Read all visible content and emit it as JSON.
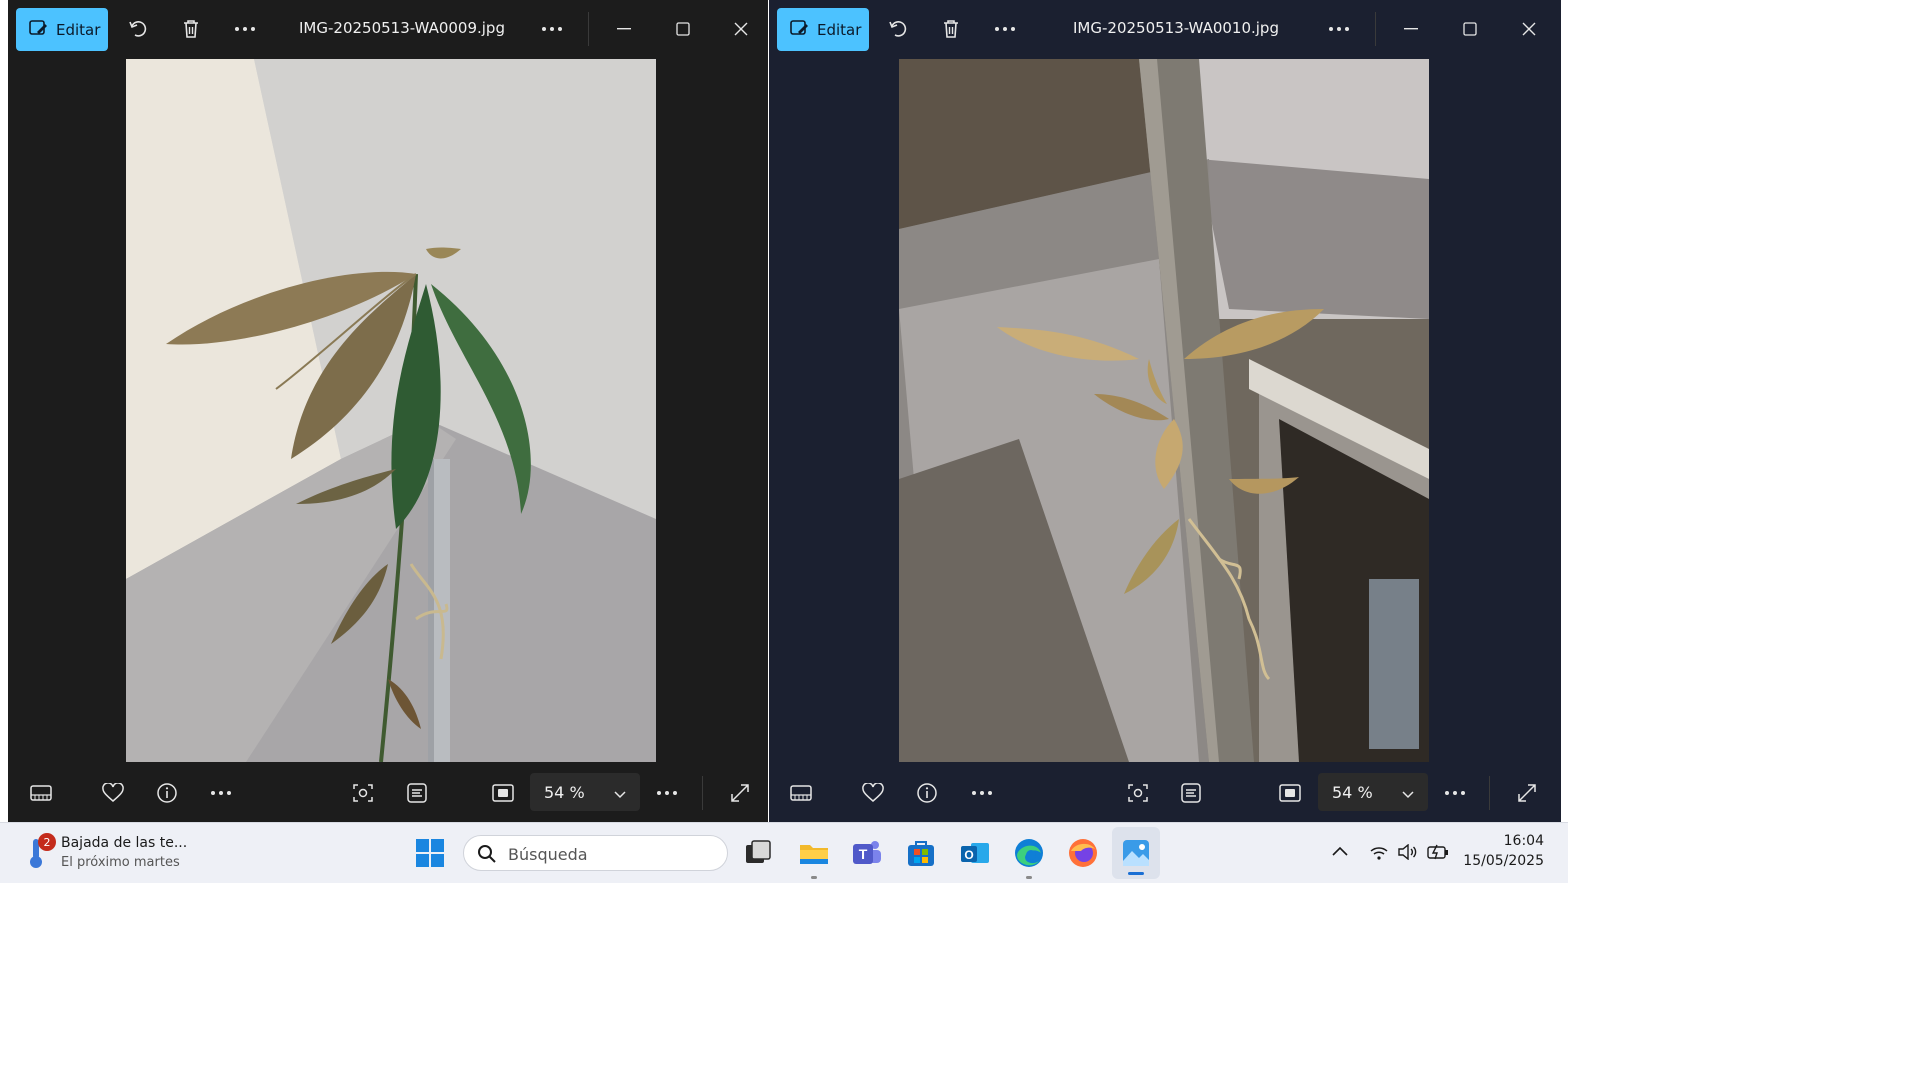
{
  "window_left": {
    "edit_label": "Editar",
    "filename": "IMG-20250513-WA0009.jpg",
    "zoom_value": "54 %"
  },
  "window_right": {
    "edit_label": "Editar",
    "filename": "IMG-20250513-WA0010.jpg",
    "zoom_value": "54 %"
  },
  "taskbar": {
    "weather_title": "Bajada de las te...",
    "weather_subtitle": "El próximo martes",
    "weather_badge": "2",
    "search_placeholder": "Búsqueda",
    "clock_time": "16:04",
    "clock_date": "15/05/2025",
    "apps": [
      "file-explorer",
      "teams",
      "microsoft-store",
      "outlook",
      "edge",
      "firefox",
      "photos"
    ]
  },
  "colors": {
    "accent": "#4cc2ff",
    "window_bg": "#1c1c1c",
    "taskbar_bg": "#eef0f6"
  }
}
